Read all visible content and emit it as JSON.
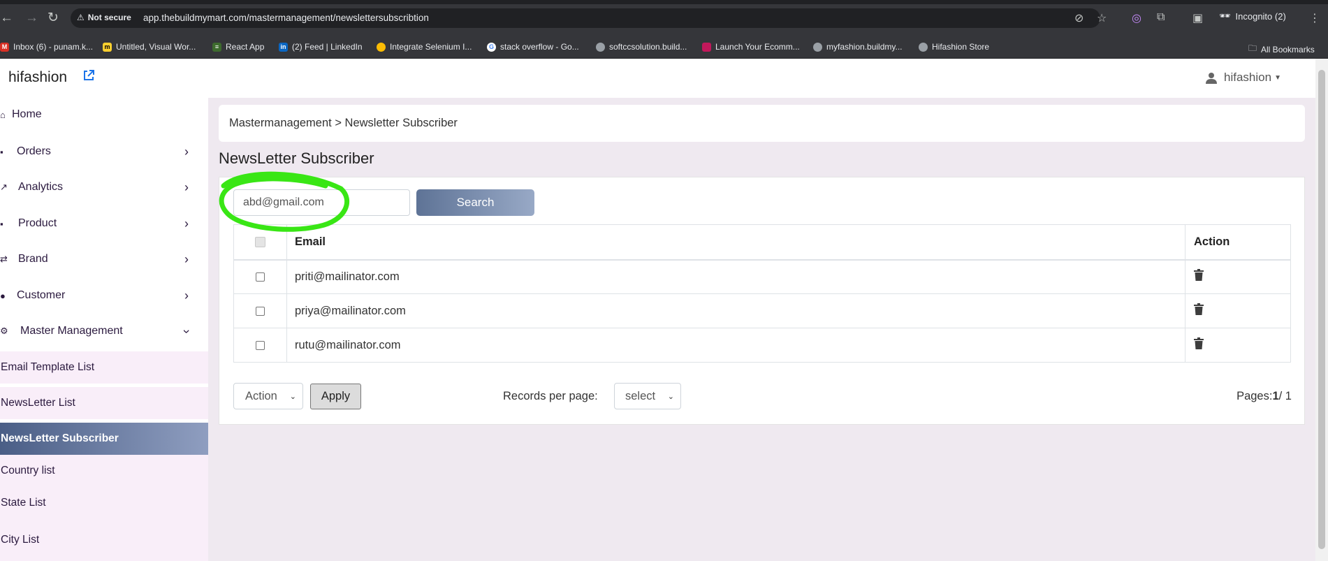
{
  "browser": {
    "security_label": "Not secure",
    "url": "app.thebuildmymart.com/mastermanagement/newslettersubscribtion",
    "incognito_label": "Incognito (2)",
    "all_bookmarks": "All Bookmarks",
    "bookmarks": [
      {
        "label": "Inbox (6) - punam.k...",
        "icon": "gmail-icon",
        "color": "#d93025"
      },
      {
        "label": "Untitled, Visual Wor...",
        "icon": "miro-icon",
        "color": "#ffd02f"
      },
      {
        "label": "React App",
        "icon": "react-icon",
        "color": "#3e6b2e"
      },
      {
        "label": "(2) Feed | LinkedIn",
        "icon": "linkedin-icon",
        "color": "#0a66c2"
      },
      {
        "label": "Integrate Selenium I...",
        "icon": "chrome-icon",
        "color": "#fbbc04"
      },
      {
        "label": "stack overflow - Go...",
        "icon": "google-icon",
        "color": "#4285f4"
      },
      {
        "label": "softccsolution.build...",
        "icon": "globe-icon",
        "color": "#9aa0a6"
      },
      {
        "label": "Launch Your Ecomm...",
        "icon": "store-icon",
        "color": "#c2185b"
      },
      {
        "label": "myfashion.buildmy...",
        "icon": "globe-icon",
        "color": "#9aa0a6"
      },
      {
        "label": "Hifashion Store",
        "icon": "globe-icon",
        "color": "#9aa0a6"
      }
    ]
  },
  "header": {
    "brand": "hifashion",
    "user": "hifashion"
  },
  "sidebar": {
    "items": [
      {
        "label": "Home",
        "icon": "home-icon",
        "has_chevron": false
      },
      {
        "label": "Orders",
        "icon": "bag-icon",
        "has_chevron": true
      },
      {
        "label": "Analytics",
        "icon": "chart-icon",
        "has_chevron": true
      },
      {
        "label": "Product",
        "icon": "box-icon",
        "has_chevron": true
      },
      {
        "label": "Brand",
        "icon": "brand-icon",
        "has_chevron": true
      },
      {
        "label": "Customer",
        "icon": "user-icon",
        "has_chevron": true
      },
      {
        "label": "Master Management",
        "icon": "gear-icon",
        "has_chevron": true,
        "expanded": true
      }
    ],
    "sub_items": [
      {
        "label": "Email Template List",
        "active": false
      },
      {
        "label": "NewsLetter List",
        "active": false
      },
      {
        "label": "NewsLetter Subscriber",
        "active": true
      },
      {
        "label": "Country list",
        "active": false
      },
      {
        "label": "State List",
        "active": false
      },
      {
        "label": "City List",
        "active": false
      }
    ]
  },
  "main": {
    "breadcrumb": "Mastermanagement > Newsletter Subscriber",
    "title": "NewsLetter Subscriber",
    "search": {
      "value": "abd@gmail.com",
      "button": "Search"
    },
    "table": {
      "columns": [
        "",
        "Email",
        "Action"
      ],
      "rows": [
        {
          "email": "priti@mailinator.com"
        },
        {
          "email": "priya@mailinator.com"
        },
        {
          "email": "rutu@mailinator.com"
        }
      ]
    },
    "footer": {
      "action_select": "Action",
      "apply": "Apply",
      "records_label": "Records per page:",
      "records_select": "select",
      "pages_prefix": "Pages:",
      "current_page": "1",
      "total_pages": "/ 1"
    }
  },
  "colors": {
    "highlight": "#39e615",
    "active_nav_start": "#4a5e86",
    "submenu_bg": "#f9eef9"
  }
}
